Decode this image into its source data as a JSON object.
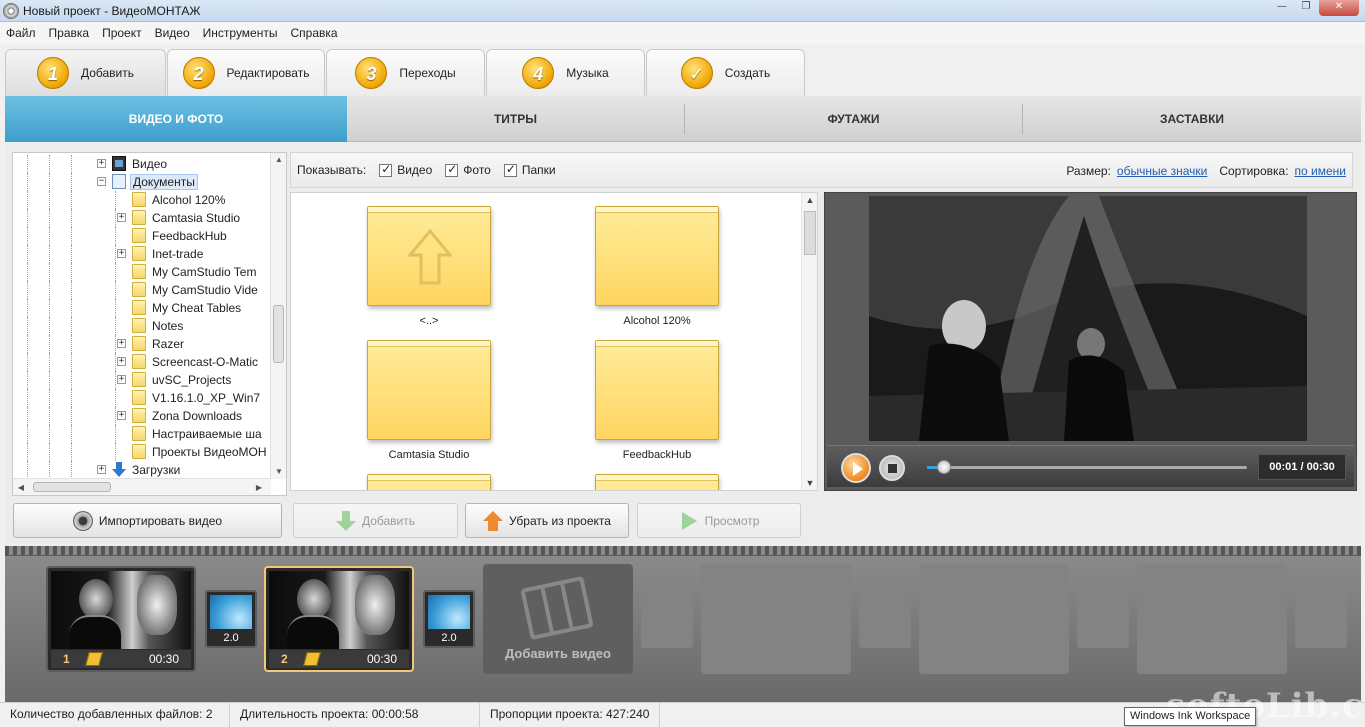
{
  "window": {
    "title": "Новый проект - ВидеоМОНТАЖ",
    "controls": [
      "—",
      "❐",
      "✕"
    ]
  },
  "menu": [
    "Файл",
    "Правка",
    "Проект",
    "Видео",
    "Инструменты",
    "Справка"
  ],
  "steps": [
    {
      "num": "1",
      "label": "Добавить",
      "active": true
    },
    {
      "num": "2",
      "label": "Редактировать"
    },
    {
      "num": "3",
      "label": "Переходы"
    },
    {
      "num": "4",
      "label": "Музыка"
    },
    {
      "num": "✓",
      "label": "Создать"
    }
  ],
  "categories": [
    {
      "label": "ВИДЕО И ФОТО",
      "active": true
    },
    {
      "label": "ТИТРЫ"
    },
    {
      "label": "ФУТАЖИ"
    },
    {
      "label": "ЗАСТАВКИ"
    }
  ],
  "tree": [
    {
      "label": "Видео",
      "level": 1,
      "expander": "+",
      "icon": "video-icon"
    },
    {
      "label": "Документы",
      "level": 1,
      "expander": "−",
      "icon": "documents-icon",
      "selected": true
    },
    {
      "label": "Alcohol 120%",
      "level": 2,
      "expander": "",
      "icon": "folder-icon"
    },
    {
      "label": "Camtasia Studio",
      "level": 2,
      "expander": "+",
      "icon": "folder-icon"
    },
    {
      "label": "FeedbackHub",
      "level": 2,
      "expander": "",
      "icon": "folder-icon"
    },
    {
      "label": "Inet-trade",
      "level": 2,
      "expander": "+",
      "icon": "folder-icon"
    },
    {
      "label": "My CamStudio Tem",
      "level": 2,
      "expander": "",
      "icon": "folder-icon"
    },
    {
      "label": "My CamStudio Vide",
      "level": 2,
      "expander": "",
      "icon": "folder-icon"
    },
    {
      "label": "My Cheat Tables",
      "level": 2,
      "expander": "",
      "icon": "folder-icon"
    },
    {
      "label": "Notes",
      "level": 2,
      "expander": "",
      "icon": "folder-icon"
    },
    {
      "label": "Razer",
      "level": 2,
      "expander": "+",
      "icon": "folder-icon"
    },
    {
      "label": "Screencast-O-Matic",
      "level": 2,
      "expander": "+",
      "icon": "folder-icon"
    },
    {
      "label": "uvSC_Projects",
      "level": 2,
      "expander": "+",
      "icon": "folder-icon"
    },
    {
      "label": "V1.16.1.0_XP_Win7",
      "level": 2,
      "expander": "",
      "icon": "folder-icon"
    },
    {
      "label": "Zona Downloads",
      "level": 2,
      "expander": "+",
      "icon": "folder-icon"
    },
    {
      "label": "Настраиваемые ша",
      "level": 2,
      "expander": "",
      "icon": "folder-icon"
    },
    {
      "label": "Проекты ВидеоМОН",
      "level": 2,
      "expander": "",
      "icon": "folder-icon"
    },
    {
      "label": "Загрузки",
      "level": 1,
      "expander": "+",
      "icon": "download-icon"
    }
  ],
  "filter": {
    "show_label": "Показывать:",
    "checks": [
      {
        "label": "Видео",
        "checked": true
      },
      {
        "label": "Фото",
        "checked": true
      },
      {
        "label": "Папки",
        "checked": true
      }
    ],
    "size_label": "Размер:",
    "size_value": "обычные значки",
    "sort_label": "Сортировка:",
    "sort_value": "по имени"
  },
  "files": [
    {
      "name": "<..>",
      "type": "up"
    },
    {
      "name": "Alcohol 120%",
      "type": "folder"
    },
    {
      "name": "Camtasia Studio",
      "type": "folder"
    },
    {
      "name": "FeedbackHub",
      "type": "folder"
    }
  ],
  "player": {
    "time": "00:01 / 00:30",
    "progress": 0.03
  },
  "actions": {
    "import": "Импортировать видео",
    "add": "Добавить",
    "remove": "Убрать из проекта",
    "preview": "Просмотр"
  },
  "timeline": {
    "clips": [
      {
        "index": "1",
        "duration": "00:30"
      },
      {
        "index": "2",
        "duration": "00:30",
        "selected": true
      }
    ],
    "transitions": [
      "2.0",
      "2.0"
    ],
    "add_video": "Добавить видео"
  },
  "status": {
    "files": "Количество добавленных файлов: 2",
    "duration": "Длительность проекта:   00:00:58",
    "ratio": "Пропорции проекта:   427:240"
  },
  "tooltip": "Windows Ink Workspace",
  "watermark": "softoLib.com",
  "colors": {
    "accent": "#3e9fcc",
    "step_badge": "#f0a400",
    "selected_clip": "#f3c77a"
  }
}
